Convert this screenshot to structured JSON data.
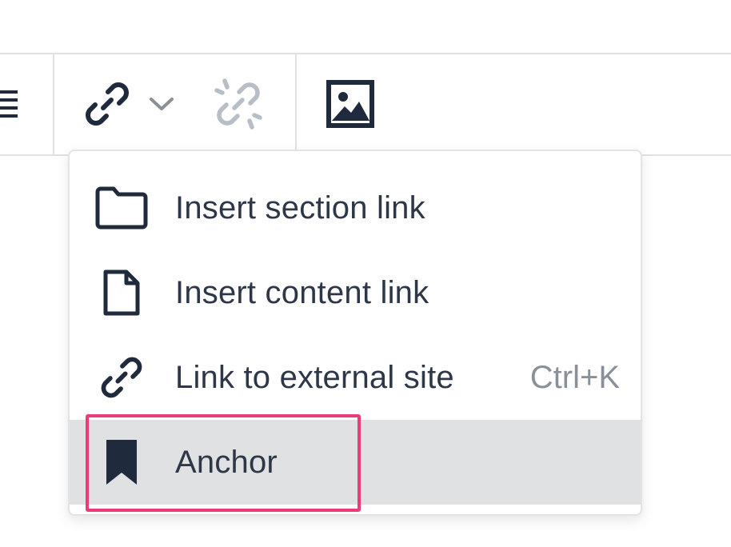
{
  "toolbar": {
    "buttons": [
      {
        "name": "list-icon",
        "enabled": true
      },
      {
        "name": "link-icon",
        "enabled": true
      },
      {
        "name": "chevron-down-icon",
        "enabled": true
      },
      {
        "name": "unlink-icon",
        "enabled": false
      },
      {
        "name": "image-icon",
        "enabled": true
      }
    ]
  },
  "dropdown": {
    "items": [
      {
        "label": "Insert section link",
        "icon": "folder-icon",
        "shortcut": ""
      },
      {
        "label": "Insert content link",
        "icon": "document-icon",
        "shortcut": ""
      },
      {
        "label": "Link to external site",
        "icon": "link-icon",
        "shortcut": "Ctrl+K"
      },
      {
        "label": "Anchor",
        "icon": "bookmark-icon",
        "shortcut": "",
        "active": true
      }
    ]
  },
  "colors": {
    "icon": "#1f2a3c",
    "text": "#2d3748",
    "muted": "#8a9099",
    "disabled": "#b7bec7",
    "hover_bg": "#e0e1e3",
    "highlight": "#ec3b78",
    "border": "#dfe1e5"
  }
}
